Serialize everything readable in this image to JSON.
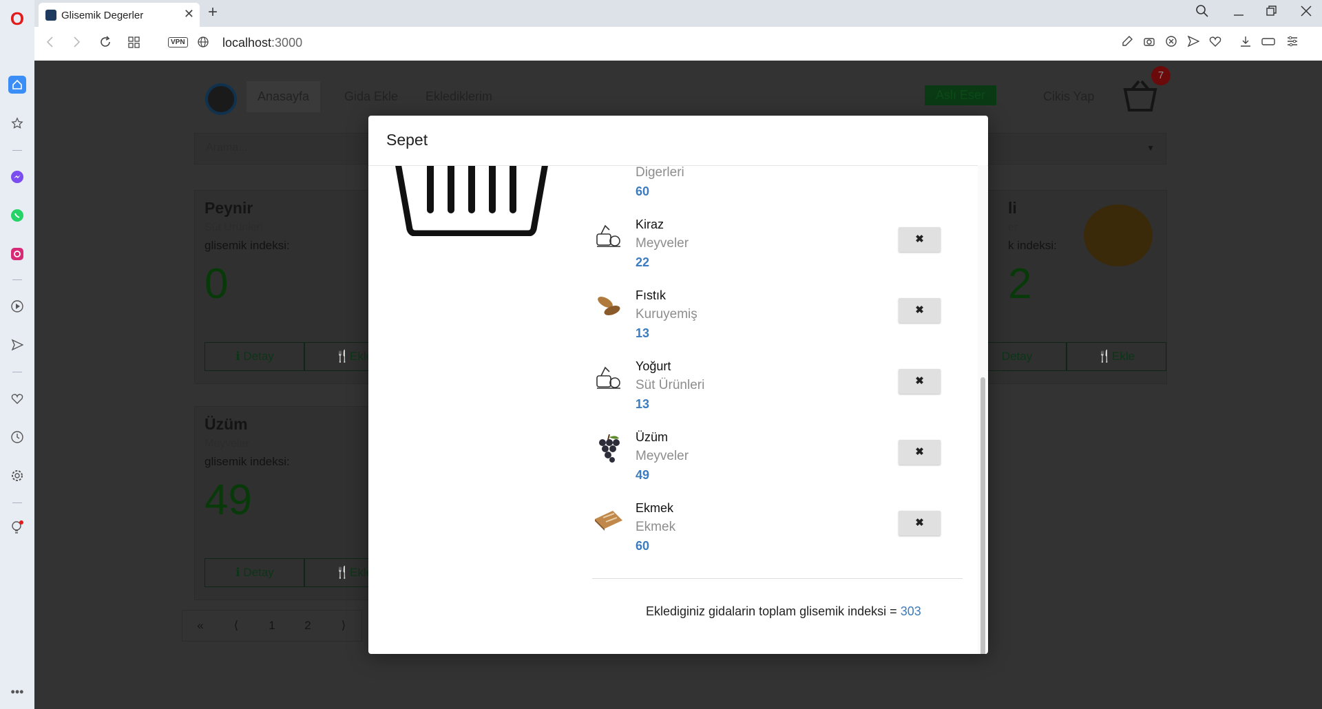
{
  "browser": {
    "tab_title": "Glisemik Degerler",
    "tab_close": "✕",
    "new_tab": "+",
    "url_host": "localhost",
    "url_port": ":3000",
    "vpn_label": "VPN"
  },
  "site": {
    "nav": {
      "home": "Anasayfa",
      "add_food": "Gida Ekle",
      "added": "Eklediklerim"
    },
    "user_name": "Aslı Eser",
    "logout": "Cikis Yap",
    "cart_count": "7",
    "search_placeholder": "Arama...",
    "cards": [
      {
        "title": "Peynir",
        "category": "Süt Ürünleri",
        "gi_label": "glisemik indeksi:",
        "gi": "0",
        "detail": "Detay",
        "add": "Ekle"
      },
      {
        "title": "Üzüm",
        "category": "Meyveler",
        "gi_label": "glisemik indeksi:",
        "gi": "49",
        "detail": "Detay",
        "add": "Ekle"
      },
      {
        "title": "li",
        "category": "er",
        "gi_label": "k indeksi:",
        "gi": "2",
        "detail": "Detay",
        "add": "Ekle"
      }
    ],
    "pagination": [
      "«",
      "⟨",
      "1",
      "2",
      "⟩"
    ]
  },
  "modal": {
    "title": "Sepet",
    "items": [
      {
        "name": "",
        "category": "Digerleri",
        "gi": "60",
        "thumb": "generic-icon"
      },
      {
        "name": "Kiraz",
        "category": "Meyveler",
        "gi": "22",
        "thumb": "generic-food-icon"
      },
      {
        "name": "Fıstık",
        "category": "Kuruyemiş",
        "gi": "13",
        "thumb": "peanut-icon"
      },
      {
        "name": "Yoğurt",
        "category": "Süt Ürünleri",
        "gi": "13",
        "thumb": "generic-food-icon"
      },
      {
        "name": "Üzüm",
        "category": "Meyveler",
        "gi": "49",
        "thumb": "grape-icon"
      },
      {
        "name": "Ekmek",
        "category": "Ekmek",
        "gi": "60",
        "thumb": "bread-icon"
      }
    ],
    "remove_label": "✖",
    "total_text": "Eklediginiz gidalarin toplam glisemik indeksi = ",
    "total_value": "303"
  }
}
